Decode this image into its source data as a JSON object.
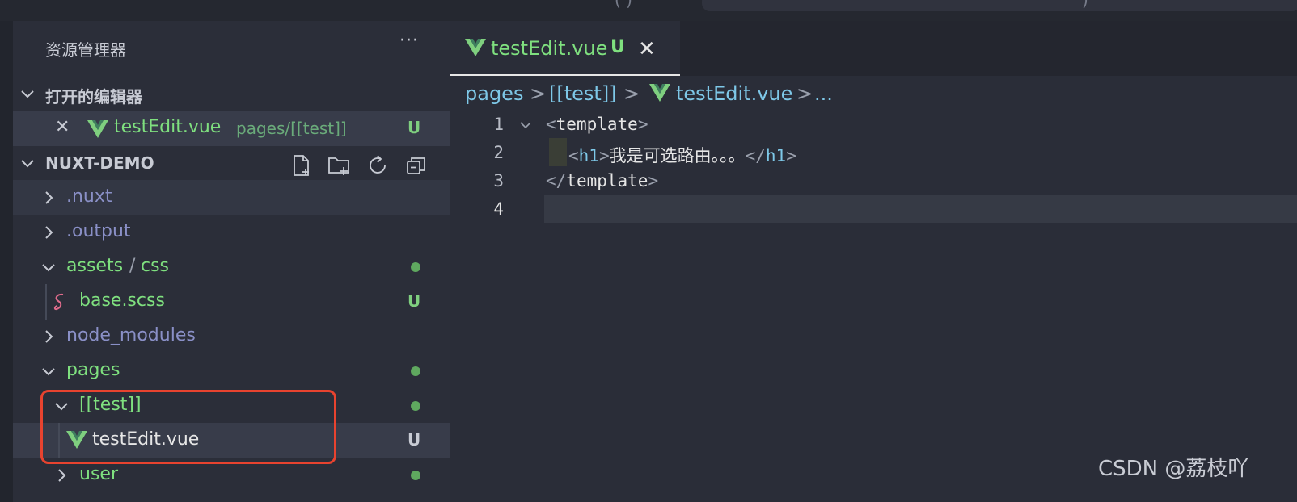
{
  "explorer": {
    "title": "资源管理器",
    "more": "···",
    "open_editors": {
      "header": "打开的编辑器",
      "items": [
        {
          "close": "✕",
          "name": "testEdit.vue",
          "path": "pages/[[test]]",
          "badge": "U"
        }
      ]
    },
    "project": {
      "header": "NUXT-DEMO",
      "tools": [
        "new-file-icon",
        "new-folder-icon",
        "refresh-icon",
        "collapse-all-icon"
      ],
      "tree": [
        {
          "label": ".nuxt"
        },
        {
          "label": ".output"
        },
        {
          "label": "assets",
          "sep": "/",
          "label2": "css"
        },
        {
          "label": "base.scss",
          "badge": "U"
        },
        {
          "label": "node_modules"
        },
        {
          "label": "pages"
        },
        {
          "label": "[[test]]"
        },
        {
          "label": "testEdit.vue",
          "badge": "U"
        },
        {
          "label": "user"
        }
      ]
    }
  },
  "editor": {
    "tab": {
      "name": "testEdit.vue",
      "badge": "U",
      "close": "✕"
    },
    "breadcrumb": [
      "pages",
      "[[test]]",
      "testEdit.vue",
      "..."
    ],
    "breadcrumb_sep": ">",
    "lines": [
      {
        "num": "1",
        "open": "<",
        "tag": "template",
        "close": ">"
      },
      {
        "num": "2",
        "open": "<",
        "tag": "h1",
        "close": ">",
        "text": "我是可选路由。。。",
        "end_open": "</",
        "end_tag": "h1",
        "end_close": ">"
      },
      {
        "num": "3",
        "open": "</",
        "tag": "template",
        "close": ">"
      },
      {
        "num": "4"
      }
    ]
  },
  "watermark": "CSDN @荔枝吖",
  "top_fragments": [
    "(   )",
    ")"
  ],
  "colors": {
    "accent_green": "#7fe07f",
    "folder_dim": "#8a90c7",
    "tag_blue": "#7ec8e8",
    "highlight_red": "#e8432f"
  }
}
